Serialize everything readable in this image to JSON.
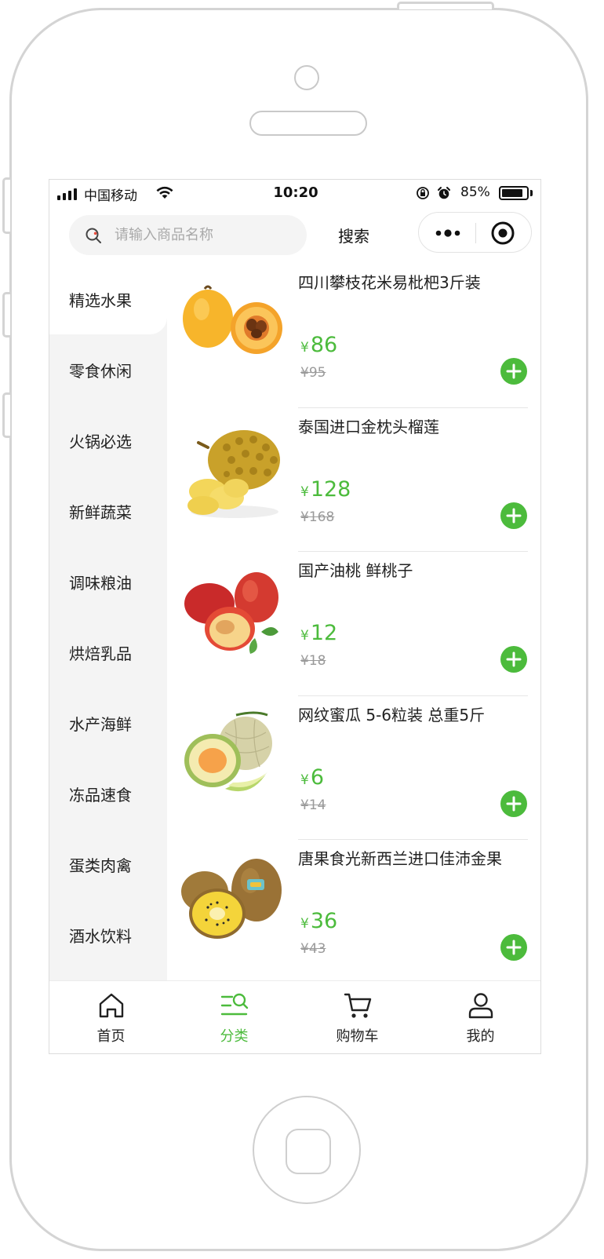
{
  "status_bar": {
    "carrier": "中国移动",
    "time": "10:20",
    "battery": "85%",
    "battery_level": 0.85
  },
  "search": {
    "placeholder": "请输入商品名称",
    "button_label": "搜索"
  },
  "categories": [
    {
      "label": "精选水果"
    },
    {
      "label": "零食休闲"
    },
    {
      "label": "火锅必选"
    },
    {
      "label": "新鲜蔬菜"
    },
    {
      "label": "调味粮油"
    },
    {
      "label": "烘焙乳品"
    },
    {
      "label": "水产海鲜"
    },
    {
      "label": "冻品速食"
    },
    {
      "label": "蛋类肉禽"
    },
    {
      "label": "酒水饮料"
    }
  ],
  "products": [
    {
      "name": "四川攀枝花米易枇杷3斤装",
      "currency": "¥",
      "price": "86",
      "old_price": "¥95",
      "image": "loquat-image"
    },
    {
      "name": "泰国进口金枕头榴莲",
      "currency": "¥",
      "price": "128",
      "old_price": "¥168",
      "image": "durian-image"
    },
    {
      "name": "国产油桃 鲜桃子",
      "currency": "¥",
      "price": "12",
      "old_price": "¥18",
      "image": "nectarine-image"
    },
    {
      "name": "网纹蜜瓜 5-6粒装 总重5斤",
      "currency": "¥",
      "price": "6",
      "old_price": "¥14",
      "image": "melon-image"
    },
    {
      "name": "唐果食光新西兰进口佳沛金果",
      "currency": "¥",
      "price": "36",
      "old_price": "¥43",
      "image": "kiwi-image"
    }
  ],
  "tabs": [
    {
      "label": "首页",
      "icon": "home-icon"
    },
    {
      "label": "分类",
      "icon": "category-icon"
    },
    {
      "label": "购物车",
      "icon": "cart-icon"
    },
    {
      "label": "我的",
      "icon": "user-icon"
    }
  ],
  "colors": {
    "accent": "#4cbb3c",
    "sidebar_bg": "#f4f4f4",
    "old_price": "#9a9a9a"
  }
}
